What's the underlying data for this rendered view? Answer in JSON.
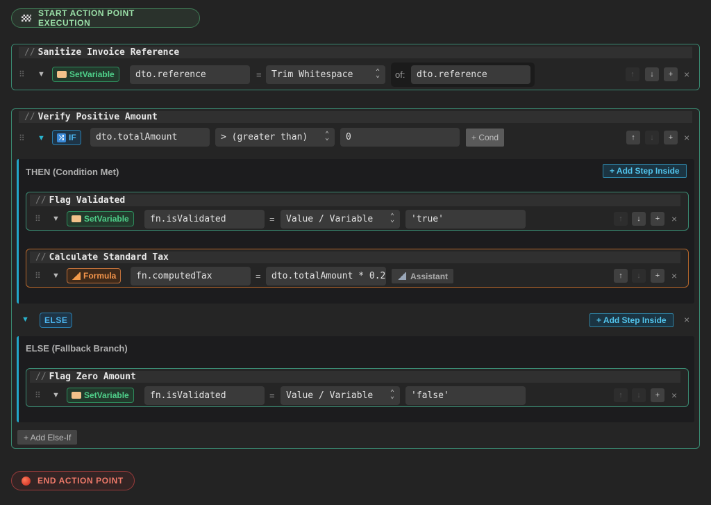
{
  "start": {
    "label": "START ACTION POINT EXECUTION"
  },
  "end": {
    "label": "END ACTION POINT"
  },
  "step1": {
    "comment": "Sanitize Invoice Reference",
    "type": "SetVariable",
    "target": "dto.reference",
    "operation": "Trim Whitespace",
    "of_label": "of:",
    "of_value": "dto.reference"
  },
  "step2": {
    "comment": "Verify Positive Amount",
    "type": "IF",
    "left": "dto.totalAmount",
    "operator": "> (greater than)",
    "right": "0",
    "cond_button": "+ Cond",
    "then": {
      "title": "THEN (Condition Met)",
      "add_button": "+ Add Step Inside",
      "step_a": {
        "comment": "Flag Validated",
        "type": "SetVariable",
        "target": "fn.isValidated",
        "mode": "Value / Variable",
        "value": "'true'"
      },
      "step_b": {
        "comment": "Calculate Standard Tax",
        "type": "Formula",
        "target": "fn.computedTax",
        "expression": "dto.totalAmount * 0.2",
        "assistant": "Assistant"
      }
    },
    "else_tag": "ELSE",
    "else": {
      "title": "ELSE (Fallback Branch)",
      "add_button": "+ Add Step Inside",
      "step_c": {
        "comment": "Flag Zero Amount",
        "type": "SetVariable",
        "target": "fn.isValidated",
        "mode": "Value / Variable",
        "value": "'false'"
      }
    },
    "add_else_if": "+ Add Else-If"
  },
  "icons": {
    "up": "↑",
    "down": "↓",
    "add": "+",
    "close": "×",
    "drag": "⠿",
    "caret": "▼"
  }
}
